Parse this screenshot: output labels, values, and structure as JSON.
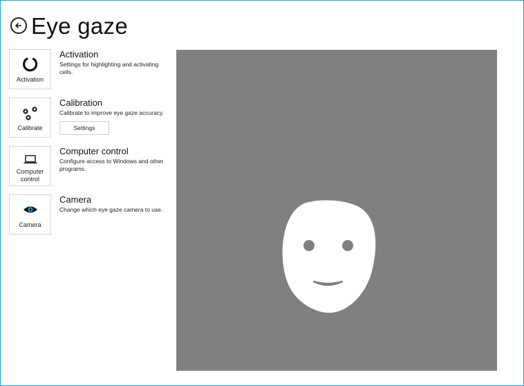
{
  "header": {
    "title": "Eye gaze",
    "back_icon": "arrow-left-circle-icon"
  },
  "settings": [
    {
      "tile_label": "Activation",
      "icon": "activation-spinner-icon",
      "title": "Activation",
      "description": "Settings for highlighting and activating cells."
    },
    {
      "tile_label": "Calibrate",
      "icon": "calibration-dots-icon",
      "title": "Calibration",
      "description": "Calibrate to improve eye gaze accuracy.",
      "button_label": "Settings"
    },
    {
      "tile_label": "Computer control",
      "icon": "laptop-icon",
      "title": "Computer control",
      "description": "Configure access to Windows and other programs."
    },
    {
      "tile_label": "Camera",
      "icon": "eye-icon",
      "title": "Camera",
      "description": "Change which eye gaze camera to use."
    }
  ],
  "preview": {
    "face_icon": "face-preview-icon",
    "background_color": "#808080",
    "face_color": "#ffffff"
  },
  "colors": {
    "window_border": "#1ba1e2",
    "camera_icon_accent": "#1ba1e2"
  }
}
